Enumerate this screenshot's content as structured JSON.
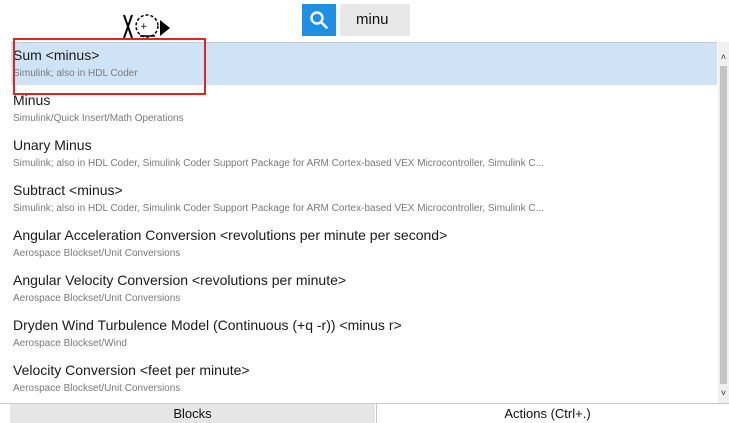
{
  "search": {
    "query": "minu",
    "button_icon": "search-icon",
    "accent_color": "#1f8fe6"
  },
  "results": [
    {
      "title": "Sum <minus>",
      "subtitle": "Simulink; also in HDL Coder"
    },
    {
      "title": "Minus",
      "subtitle": "Simulink/Quick Insert/Math Operations"
    },
    {
      "title": "Unary Minus",
      "subtitle": "Simulink; also in HDL Coder, Simulink Coder Support Package for ARM Cortex-based VEX Microcontroller, Simulink C..."
    },
    {
      "title": "Subtract <minus>",
      "subtitle": "Simulink; also in HDL Coder, Simulink Coder Support Package for ARM Cortex-based VEX Microcontroller, Simulink C..."
    },
    {
      "title": "Angular Acceleration Conversion <revolutions per minute per second>",
      "subtitle": "Aerospace Blockset/Unit Conversions"
    },
    {
      "title": "Angular Velocity Conversion <revolutions per minute>",
      "subtitle": "Aerospace Blockset/Unit Conversions"
    },
    {
      "title": "Dryden Wind Turbulence Model  (Continuous (+q -r)) <minus r>",
      "subtitle": "Aerospace Blockset/Wind"
    },
    {
      "title": "Velocity Conversion <feet per minute>",
      "subtitle": "Aerospace Blockset/Unit Conversions"
    }
  ],
  "selected_index": 0,
  "highlight_color": "#e02424",
  "selection_color": "#cfe3f6",
  "tabs": {
    "blocks": "Blocks",
    "actions": "Actions (Ctrl+.)"
  },
  "scrollbar": {
    "up_arrow": "˄",
    "down_arrow": "˅"
  }
}
